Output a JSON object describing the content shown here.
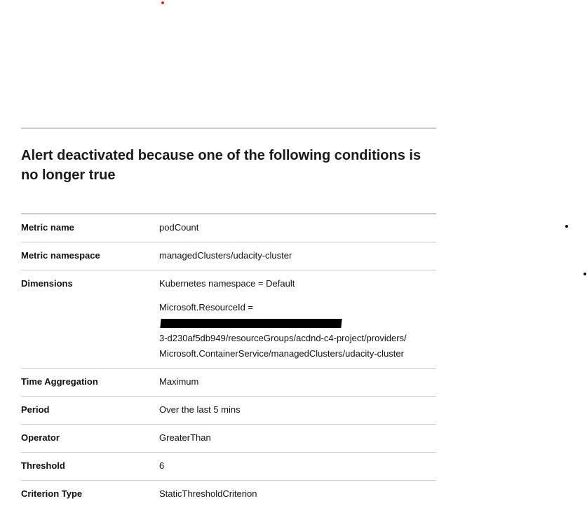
{
  "heading": "Alert deactivated because one of the following conditions is no longer true",
  "rows": [
    {
      "label": "Metric name",
      "value": "podCount"
    },
    {
      "label": "Metric namespace",
      "value": "managedClusters/udacity-cluster"
    },
    {
      "label": "Dimensions",
      "value": "Kubernetes namespace = Default",
      "resource_prefix": "Microsoft.ResourceId = ",
      "resource_line2": "3-d230af5db949/resourceGroups/acdnd-c4-project/providers/",
      "resource_line3": "Microsoft.ContainerService/managedClusters/udacity-cluster"
    },
    {
      "label": "Time Aggregation",
      "value": "Maximum"
    },
    {
      "label": "Period",
      "value": "Over the last 5 mins"
    },
    {
      "label": "Operator",
      "value": "GreaterThan"
    },
    {
      "label": "Threshold",
      "value": "6"
    },
    {
      "label": "Criterion Type",
      "value": "StaticThresholdCriterion"
    }
  ]
}
